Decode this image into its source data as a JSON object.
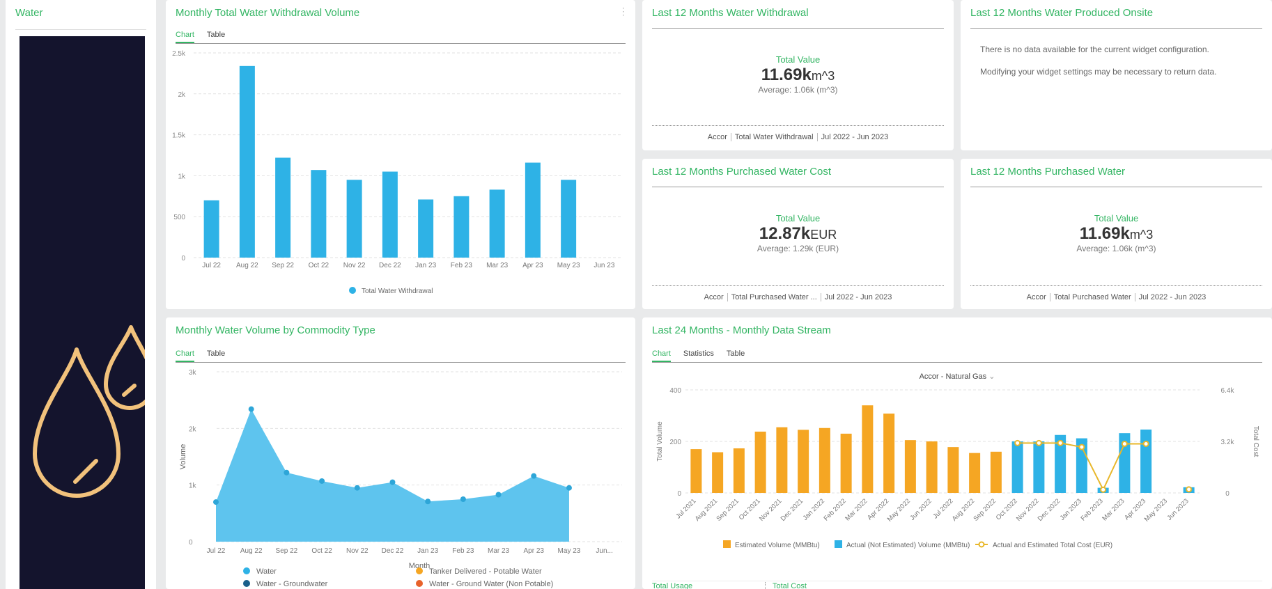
{
  "sidebar": {
    "title": "Water"
  },
  "tabs_basic": {
    "chart": "Chart",
    "table": "Table"
  },
  "tabs_stream": {
    "chart": "Chart",
    "statistics": "Statistics",
    "table": "Table"
  },
  "widgets": {
    "monthly_withdrawal": {
      "title": "Monthly Total Water Withdrawal Volume",
      "menu": "⋮"
    },
    "last12_withdrawal": {
      "title": "Last 12 Months Water Withdrawal",
      "label": "Total Value",
      "value": "11.69k",
      "unit": "m^3",
      "average": "Average: 1.06k (m^3)",
      "footer": [
        "Accor",
        "Total Water Withdrawal",
        "Jul 2022 - Jun 2023"
      ]
    },
    "produced_onsite": {
      "title": "Last 12 Months Water Produced Onsite",
      "message1": "There is no data available for the current widget configuration.",
      "message2": "Modifying your widget settings may be necessary to return data."
    },
    "purchased_cost": {
      "title": "Last 12 Months Purchased Water Cost",
      "label": "Total Value",
      "value": "12.87k",
      "unit": "EUR",
      "average": "Average: 1.29k (EUR)",
      "footer": [
        "Accor",
        "Total Purchased Water ...",
        "Jul 2022 - Jun 2023"
      ]
    },
    "purchased_water": {
      "title": "Last 12 Months Purchased Water",
      "label": "Total Value",
      "value": "11.69k",
      "unit": "m^3",
      "average": "Average: 1.06k (m^3)",
      "footer": [
        "Accor",
        "Total Purchased Water",
        "Jul 2022 - Jun 2023"
      ]
    },
    "commodity": {
      "title": "Monthly Water Volume by Commodity Type"
    },
    "stream": {
      "title": "Last 24 Months - Monthly Data Stream",
      "selector": "Accor - Natural Gas",
      "footer_left": "Total Usage",
      "footer_right": "Total Cost"
    }
  },
  "colors": {
    "accent": "#33b563",
    "bar_blue": "#2eb2e6",
    "orange": "#f5a623",
    "area": "#5ec4ee",
    "sidebar_dark": "#14142d",
    "drop": "#f2c27c"
  },
  "icons": [
    "water-drop-icon",
    "water-drop-small-icon",
    "chevron-down-icon",
    "kebab-menu-icon"
  ],
  "chart_data": [
    {
      "type": "bar",
      "categories": [
        "Jul 22",
        "Aug 22",
        "Sep 22",
        "Oct 22",
        "Nov 22",
        "Dec 22",
        "Jan 23",
        "Feb 23",
        "Mar 23",
        "Apr 23",
        "May 23",
        "Jun 23"
      ],
      "series": [
        {
          "name": "Total Water Withdrawal",
          "values": [
            700,
            2340,
            1220,
            1070,
            950,
            1050,
            710,
            750,
            830,
            1160,
            950,
            null
          ]
        }
      ],
      "yticks": [
        "0",
        "500",
        "1k",
        "1.5k",
        "2k",
        "2.5k"
      ],
      "ylim": [
        0,
        2500
      ]
    },
    {
      "type": "area",
      "categories": [
        "Jul 22",
        "Aug 22",
        "Sep 22",
        "Oct 22",
        "Nov 22",
        "Dec 22",
        "Jan 23",
        "Feb 23",
        "Mar 23",
        "Apr 23",
        "May 23",
        "Jun..."
      ],
      "series": [
        {
          "name": "Water",
          "values": [
            700,
            2340,
            1220,
            1070,
            950,
            1050,
            710,
            750,
            830,
            1160,
            950,
            null
          ]
        }
      ],
      "yticks": [
        "0",
        "1k",
        "2k",
        "3k"
      ],
      "ylim": [
        0,
        3000
      ],
      "xlabel": "Month",
      "ylabel": "Volume",
      "legend": [
        {
          "name": "Water",
          "color": "#2eb2e6"
        },
        {
          "name": "Tanker Delivered - Potable Water",
          "color": "#f5a623"
        },
        {
          "name": "Water - Groundwater",
          "color": "#1a5f8a"
        },
        {
          "name": "Water - Ground Water (Non Potable)",
          "color": "#e8622a"
        }
      ]
    },
    {
      "type": "bar",
      "categories": [
        "Jul 2021",
        "Aug 2021",
        "Sep 2021",
        "Oct 2021",
        "Nov 2021",
        "Dec 2021",
        "Jan 2022",
        "Feb 2022",
        "Mar 2022",
        "Apr 2022",
        "May 2022",
        "Jun 2022",
        "Jul 2022",
        "Aug 2022",
        "Sep 2022",
        "Oct 2022",
        "Nov 2022",
        "Dec 2022",
        "Jan 2023",
        "Feb 2023",
        "Mar 2023",
        "Apr 2023",
        "May 2023",
        "Jun 2023"
      ],
      "series": [
        {
          "name": "Estimated Volume (MMBtu)",
          "values": [
            170,
            158,
            173,
            238,
            255,
            245,
            252,
            230,
            340,
            308,
            205,
            200,
            178,
            155,
            160,
            null,
            null,
            null,
            null,
            null,
            null,
            null,
            null,
            null
          ]
        },
        {
          "name": "Actual (Not Estimated) Volume (MMBtu)",
          "values": [
            null,
            null,
            null,
            null,
            null,
            null,
            null,
            null,
            null,
            null,
            null,
            null,
            null,
            null,
            null,
            200,
            200,
            225,
            212,
            20,
            232,
            246,
            null,
            22
          ]
        },
        {
          "name": "Actual and Estimated Total Cost (EUR)",
          "values": [
            null,
            null,
            null,
            null,
            null,
            null,
            null,
            null,
            null,
            null,
            null,
            null,
            null,
            null,
            null,
            3100,
            3100,
            3100,
            2850,
            200,
            3050,
            3050,
            null,
            220
          ]
        }
      ],
      "yticks": [
        "0",
        "200",
        "400"
      ],
      "ylim": [
        0,
        400
      ],
      "y2ticks": [
        "0",
        "3.2k",
        "6.4k"
      ],
      "y2lim": [
        0,
        6400
      ],
      "ylabel": "Total Volume",
      "y2label": "Total Cost"
    }
  ]
}
